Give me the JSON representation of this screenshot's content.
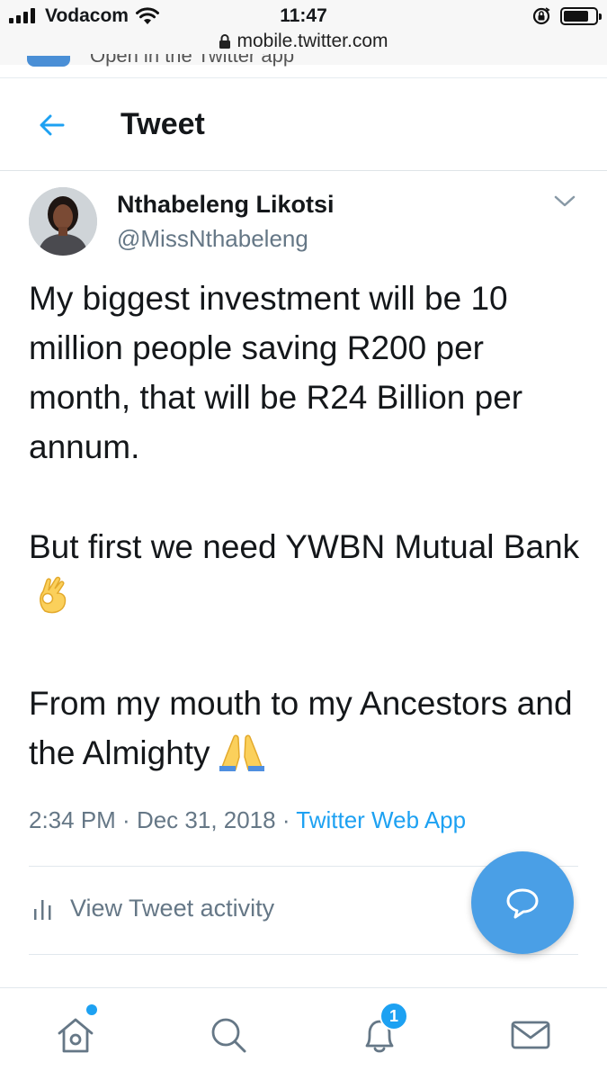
{
  "status_bar": {
    "carrier": "Vodacom",
    "time": "11:47"
  },
  "browser": {
    "url": "mobile.twitter.com",
    "banner_text": "Open in the Twitter app"
  },
  "header": {
    "title": "Tweet"
  },
  "tweet": {
    "author_name": "Nthabeleng Likotsi",
    "author_handle": "@MissNthabeleng",
    "paragraphs": [
      "My biggest investment will be 10 million people saving R200 per month, that will be R24 Billion per annum.",
      "But first we need YWBN Mutual Bank",
      "From my mouth to my Ancestors and the Almighty"
    ],
    "time": "2:34 PM",
    "separator": " · ",
    "date": "Dec 31, 2018",
    "source": "Twitter Web App",
    "activity_label": "View Tweet activity"
  },
  "icons": {
    "back": "arrow-left-icon",
    "more": "chevron-down-icon",
    "ok_hand": "ok-hand-emoji",
    "pray": "folded-hands-emoji",
    "activity": "bar-chart-icon",
    "compose": "reply-bubble-icon",
    "home": "home-icon",
    "search": "search-icon",
    "notifications": "bell-icon",
    "messages": "mail-icon"
  },
  "nav": {
    "notification_count": "1"
  },
  "colors": {
    "twitter_blue": "#1da1f2",
    "fab_blue": "#4a9fe6",
    "secondary_text": "#657786"
  }
}
